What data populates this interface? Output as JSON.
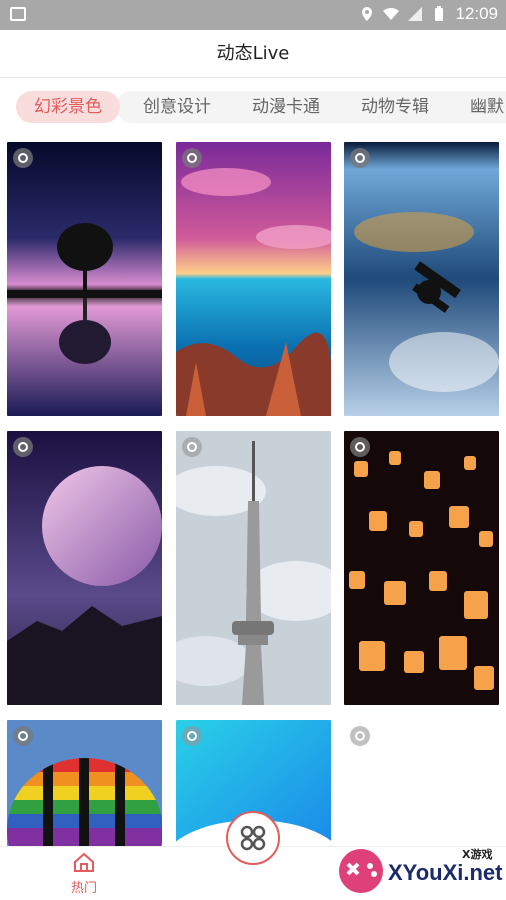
{
  "status": {
    "time": "12:09"
  },
  "header": {
    "title": "动态Live"
  },
  "tabs": [
    {
      "label": "幻彩景色",
      "active": true
    },
    {
      "label": "创意设计"
    },
    {
      "label": "动漫卡通"
    },
    {
      "label": "动物专辑"
    },
    {
      "label": "幽默"
    }
  ],
  "cards": [
    {
      "subject": "tree-reflection-night"
    },
    {
      "subject": "ocean-coral-sunset"
    },
    {
      "subject": "space-station-earth"
    },
    {
      "subject": "planet-mountains"
    },
    {
      "subject": "cn-tower"
    },
    {
      "subject": "sky-lanterns"
    },
    {
      "subject": "hot-air-balloon"
    },
    {
      "subject": "blue-gradient"
    },
    {
      "subject": "empty"
    }
  ],
  "bottom_nav": {
    "hot_label": "热门"
  },
  "watermark": {
    "text": "XYouXi.net",
    "small": "X游戏"
  },
  "colors": {
    "accent": "#e35b5b",
    "tab_active_bg": "#f9dcdc"
  }
}
